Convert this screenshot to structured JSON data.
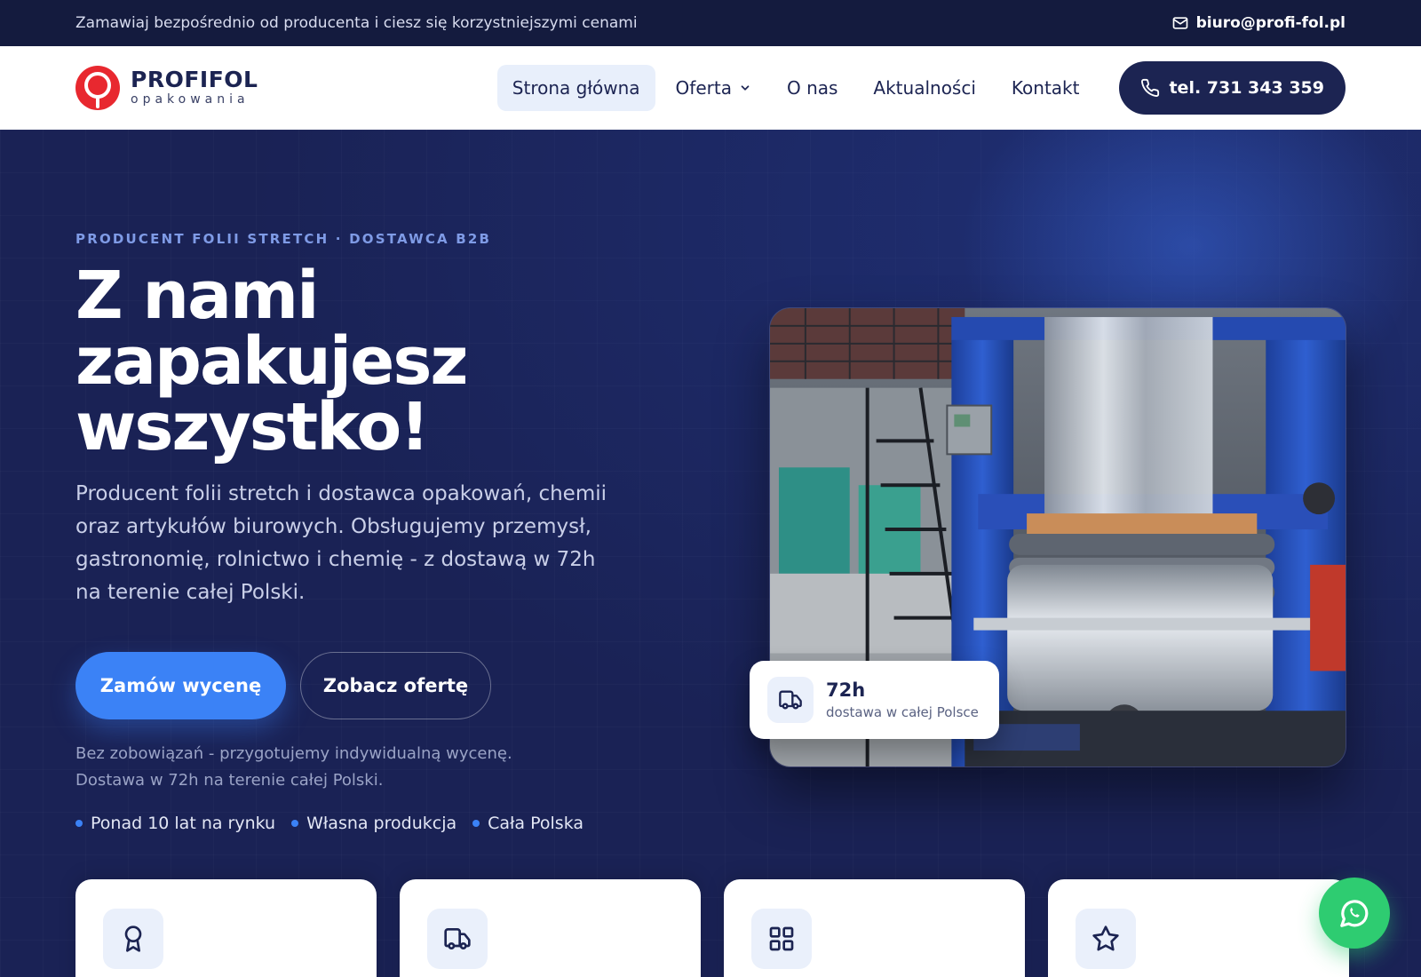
{
  "topbar": {
    "tagline": "Zamawiaj bezpośrednio od producenta i ciesz się korzystniejszymi cenami",
    "email": "biuro@profi-fol.pl"
  },
  "brand": {
    "name": "PROFIFOL",
    "subtitle": "opakowania",
    "logo_color": "#e8282f"
  },
  "nav": {
    "items": [
      {
        "label": "Strona główna",
        "active": true
      },
      {
        "label": "Oferta"
      },
      {
        "label": "O nas"
      },
      {
        "label": "Aktualności"
      },
      {
        "label": "Kontakt"
      }
    ],
    "phone_label": "tel. 731 343 359"
  },
  "hero": {
    "eyebrow": "PRODUCENT FOLII STRETCH · DOSTAWCA B2B",
    "headline": "Z nami zapakujesz wszystko!",
    "lead": "Producent folii stretch i dostawca opakowań, chemii oraz artykułów biurowych. Obsługujemy przemysł, gastronomię, rolnictwo i chemię - z dostawą w 72h na terenie całej Polski.",
    "primary_cta": "Zamów wycenę",
    "secondary_cta": "Zobacz ofertę",
    "note_line1": "Bez zobowiązań - przygotujemy indywidualną wycenę.",
    "note_line2": "Dostawa w 72h na terenie całej Polski.",
    "bullets": [
      "Ponad 10 lat na rynku",
      "Własna produkcja",
      "Cała Polska"
    ],
    "badge": {
      "value": "72h",
      "text": "dostawa w całej Polsce",
      "icon": "truck-icon"
    }
  },
  "feature_cards": [
    {
      "icon": "award-icon"
    },
    {
      "icon": "truck-icon"
    },
    {
      "icon": "grid-icon"
    },
    {
      "icon": "star-icon"
    }
  ],
  "colors": {
    "navy": "#1c2452",
    "hero_bg": "#1a2255",
    "accent_blue": "#3b82f6",
    "whatsapp_green": "#2ecc71"
  }
}
